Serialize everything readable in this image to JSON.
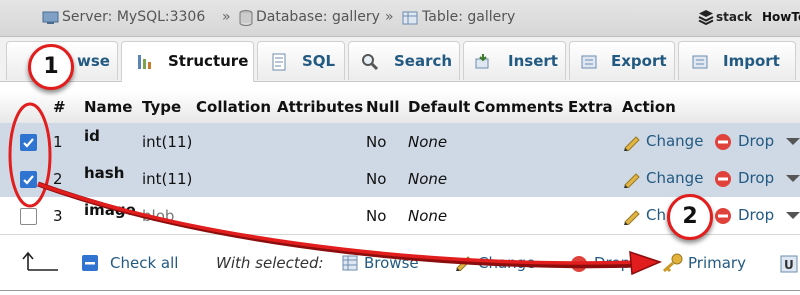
{
  "breadcrumb": {
    "server": "Server: MySQL:3306",
    "database": "Database: gallery",
    "table": "Table: gallery",
    "separator": "»"
  },
  "brand": {
    "part1": "stack",
    "part2": "HowTo"
  },
  "tabs": [
    {
      "label": "Browse",
      "icon": "browse-icon"
    },
    {
      "label": "Structure",
      "icon": "structure-icon",
      "active": true
    },
    {
      "label": "SQL",
      "icon": "sql-icon"
    },
    {
      "label": "Search",
      "icon": "search-icon"
    },
    {
      "label": "Insert",
      "icon": "insert-icon"
    },
    {
      "label": "Export",
      "icon": "export-icon"
    },
    {
      "label": "Import",
      "icon": "import-icon"
    }
  ],
  "tab_visible": {
    "browse": "wse"
  },
  "columns": [
    "#",
    "Name",
    "Type",
    "Collation",
    "Attributes",
    "Null",
    "Default",
    "Comments",
    "Extra",
    "Action"
  ],
  "rows": [
    {
      "num": "1",
      "name": "id",
      "type": "int(11)",
      "null": "No",
      "default": "None",
      "checked": true
    },
    {
      "num": "2",
      "name": "hash",
      "type": "int(11)",
      "null": "No",
      "default": "None",
      "checked": true
    },
    {
      "num": "3",
      "name": "image",
      "type": "blob",
      "null": "No",
      "default": "None",
      "checked": false
    }
  ],
  "row_actions": {
    "change": "Change",
    "drop": "Drop",
    "change_partial": "Ch"
  },
  "bottom": {
    "check_all": "Check all",
    "with_selected": "With selected:",
    "browse": "Browse",
    "change": "Change",
    "drop": "Drop",
    "primary": "Primary"
  },
  "annotations": {
    "step1": "1",
    "step2": "2",
    "color": "#e21d1d"
  }
}
